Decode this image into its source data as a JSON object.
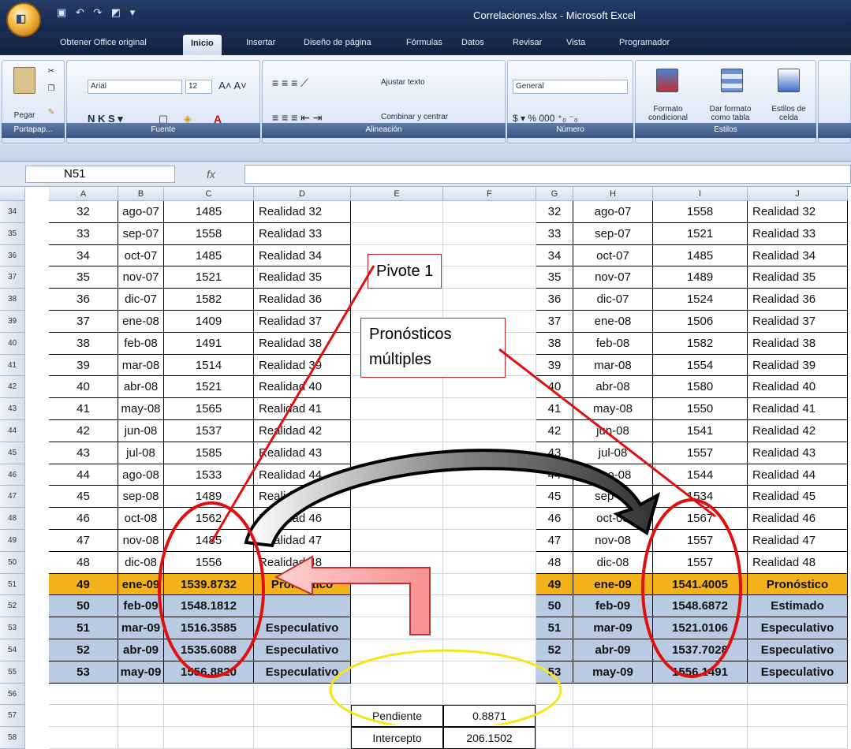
{
  "window": {
    "title": "Correlaciones.xlsx - Microsoft Excel"
  },
  "ribbon": {
    "tabs": [
      "Obtener Office original",
      "Inicio",
      "Insertar",
      "Diseño de página",
      "Fórmulas",
      "Datos",
      "Revisar",
      "Vista",
      "Programador"
    ],
    "paste": "Pegar",
    "clipboard": "Portapap...",
    "font_name": "Arial",
    "font_size": "12",
    "font_group": "Fuente",
    "wrap_text": "Ajustar texto",
    "merge_center": "Combinar y centrar",
    "alignment_group": "Alineación",
    "number_format": "General",
    "number_group": "Número",
    "cond_format": "Formato condicional",
    "format_table": "Dar formato como tabla",
    "cell_styles": "Estilos de celda",
    "styles_group": "Estilos"
  },
  "formula_bar": {
    "name_box": "N51",
    "fx": "fx"
  },
  "columns": [
    "A",
    "B",
    "C",
    "D",
    "E",
    "F",
    "G",
    "H",
    "I",
    "J"
  ],
  "rows_hdr": [
    "34",
    "35",
    "36",
    "37",
    "38",
    "39",
    "40",
    "41",
    "42",
    "43",
    "44",
    "45",
    "46",
    "47",
    "48",
    "49",
    "50",
    "51",
    "52",
    "53",
    "54",
    "55",
    "56",
    "57",
    "58"
  ],
  "left_table": [
    [
      "32",
      "ago-07",
      "1485",
      "Realidad 32"
    ],
    [
      "33",
      "sep-07",
      "1558",
      "Realidad 33"
    ],
    [
      "34",
      "oct-07",
      "1485",
      "Realidad 34"
    ],
    [
      "35",
      "nov-07",
      "1521",
      "Realidad 35"
    ],
    [
      "36",
      "dic-07",
      "1582",
      "Realidad 36"
    ],
    [
      "37",
      "ene-08",
      "1409",
      "Realidad 37"
    ],
    [
      "38",
      "feb-08",
      "1491",
      "Realidad 38"
    ],
    [
      "39",
      "mar-08",
      "1514",
      "Realidad 39"
    ],
    [
      "40",
      "abr-08",
      "1521",
      "Realidad 40"
    ],
    [
      "41",
      "may-08",
      "1565",
      "Realidad 41"
    ],
    [
      "42",
      "jun-08",
      "1537",
      "Realidad 42"
    ],
    [
      "43",
      "jul-08",
      "1585",
      "Realidad 43"
    ],
    [
      "44",
      "ago-08",
      "1533",
      "Realidad 44"
    ],
    [
      "45",
      "sep-08",
      "1489",
      "Realidad 45"
    ],
    [
      "46",
      "oct-08",
      "1562",
      "Realidad 46"
    ],
    [
      "47",
      "nov-08",
      "1485",
      "Realidad 47"
    ],
    [
      "48",
      "dic-08",
      "1556",
      "Realidad 48"
    ],
    [
      "49",
      "ene-09",
      "1539.8732",
      "Pronóstico"
    ],
    [
      "50",
      "feb-09",
      "1548.1812",
      ""
    ],
    [
      "51",
      "mar-09",
      "1516.3585",
      "Especulativo"
    ],
    [
      "52",
      "abr-09",
      "1535.6088",
      "Especulativo"
    ],
    [
      "53",
      "may-09",
      "1556.8820",
      "Especulativo"
    ]
  ],
  "right_table": [
    [
      "32",
      "ago-07",
      "1558",
      "Realidad 32"
    ],
    [
      "33",
      "sep-07",
      "1521",
      "Realidad 33"
    ],
    [
      "34",
      "oct-07",
      "1485",
      "Realidad 34"
    ],
    [
      "35",
      "nov-07",
      "1489",
      "Realidad 35"
    ],
    [
      "36",
      "dic-07",
      "1524",
      "Realidad 36"
    ],
    [
      "37",
      "ene-08",
      "1506",
      "Realidad 37"
    ],
    [
      "38",
      "feb-08",
      "1582",
      "Realidad 38"
    ],
    [
      "39",
      "mar-08",
      "1554",
      "Realidad 39"
    ],
    [
      "40",
      "abr-08",
      "1580",
      "Realidad 40"
    ],
    [
      "41",
      "may-08",
      "1550",
      "Realidad 41"
    ],
    [
      "42",
      "jun-08",
      "1541",
      "Realidad 42"
    ],
    [
      "43",
      "jul-08",
      "1557",
      "Realidad 43"
    ],
    [
      "44",
      "ago-08",
      "1544",
      "Realidad 44"
    ],
    [
      "45",
      "sep-08",
      "1534",
      "Realidad 45"
    ],
    [
      "46",
      "oct-08",
      "1567",
      "Realidad 46"
    ],
    [
      "47",
      "nov-08",
      "1557",
      "Realidad 47"
    ],
    [
      "48",
      "dic-08",
      "1557",
      "Realidad 48"
    ],
    [
      "49",
      "ene-09",
      "1541.4005",
      "Pronóstico"
    ],
    [
      "50",
      "feb-09",
      "1548.6872",
      "Estimado"
    ],
    [
      "51",
      "mar-09",
      "1521.0106",
      "Especulativo"
    ],
    [
      "52",
      "abr-09",
      "1537.7028",
      "Especulativo"
    ],
    [
      "53",
      "may-09",
      "1556.1491",
      "Especulativo"
    ]
  ],
  "stats": {
    "slope_label": "Pendiente",
    "slope": "0.8871",
    "intercept_label": "Intercepto",
    "intercept": "206.1502"
  },
  "callouts": {
    "pivot": "Pivote 1",
    "multi_line1": "Pronósticos",
    "multi_line2": "múltiples"
  },
  "colors": {
    "highlight": "#f3b21a",
    "spec": "#b9cbe3",
    "circle": "#e01010",
    "ellipse": "#f5e51a"
  }
}
